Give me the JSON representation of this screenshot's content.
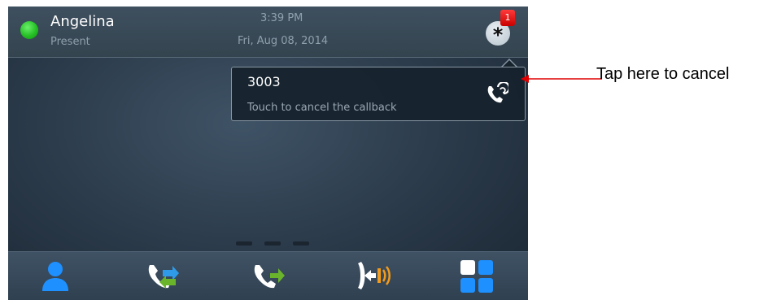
{
  "status_bar": {
    "user_name": "Angelina",
    "presence_status": "Present",
    "presence_color": "#25c025",
    "time": "3:39 PM",
    "date": "Fri, Aug 08, 2014",
    "notification_icon": "asterisk-icon",
    "notification_count": "1"
  },
  "callback_popup": {
    "number": "3003",
    "hint": "Touch to cancel the callback",
    "icon": "callback-cancel-icon"
  },
  "page_indicator": {
    "pages": 3
  },
  "dock": {
    "items": [
      {
        "icon": "contacts-icon"
      },
      {
        "icon": "call-transfer-icon"
      },
      {
        "icon": "call-forward-icon"
      },
      {
        "icon": "intercom-icon"
      },
      {
        "icon": "apps-grid-icon"
      }
    ]
  },
  "annotation": {
    "text": "Tap here to cancel",
    "arrow_color": "#e00000"
  }
}
